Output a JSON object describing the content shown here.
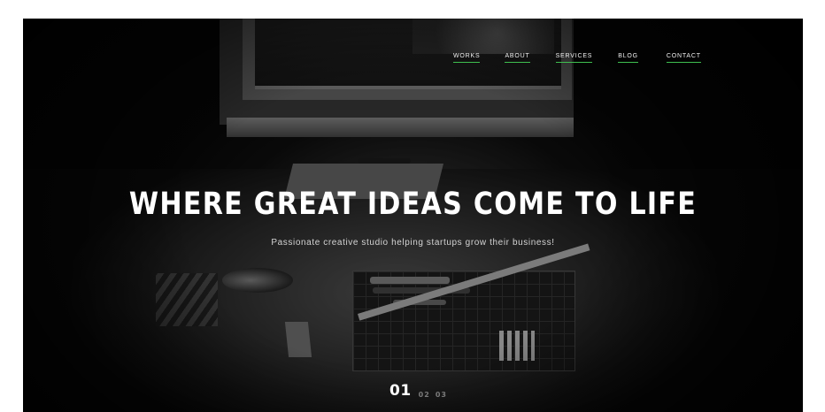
{
  "nav": {
    "items": [
      {
        "label": "WORKS"
      },
      {
        "label": "ABOUT"
      },
      {
        "label": "SERVICES"
      },
      {
        "label": "BLOG"
      },
      {
        "label": "CONTACT"
      }
    ],
    "underline_color": "#3fbf4f"
  },
  "hero": {
    "headline": "WHERE GREAT IDEAS COME TO LIFE",
    "subheadline": "Passionate creative studio helping startups grow their business!",
    "background_image": "workspace-desk-photo"
  },
  "pager": {
    "pages": [
      "01",
      "02",
      "03"
    ],
    "active": "01"
  }
}
